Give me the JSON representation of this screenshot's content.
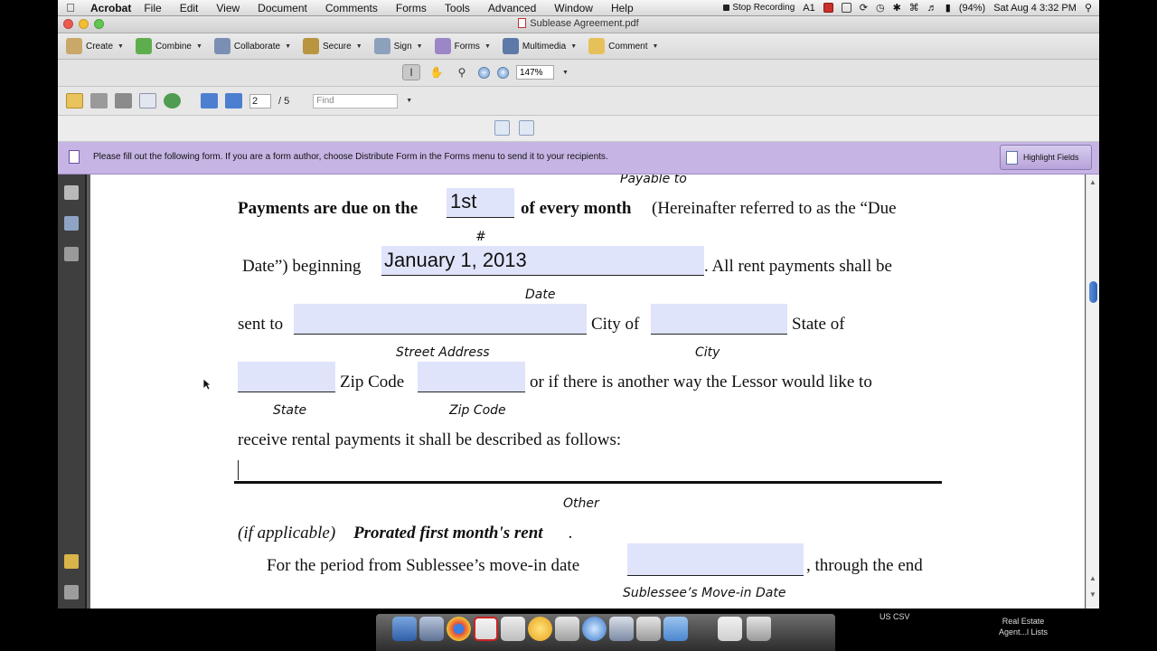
{
  "menubar": {
    "app_name": "Acrobat",
    "items": [
      "File",
      "Edit",
      "View",
      "Document",
      "Comments",
      "Forms",
      "Tools",
      "Advanced",
      "Window",
      "Help"
    ],
    "stop_recording": "Stop Recording",
    "badge_count": "1",
    "battery": "(94%)",
    "datetime": "Sat Aug 4  3:32 PM"
  },
  "window": {
    "title": "Sublease Agreement.pdf"
  },
  "toolbar1": [
    "Create",
    "Combine",
    "Collaborate",
    "Secure",
    "Sign",
    "Forms",
    "Multimedia",
    "Comment"
  ],
  "toolbar2": {
    "zoom": "147%"
  },
  "toolbar3": {
    "page_current": "2",
    "page_total": "/  5",
    "find_placeholder": "Find"
  },
  "form_bar": {
    "message": "Please fill out the following form. If you are a form author, choose Distribute Form in the Forms menu to send it to your recipients.",
    "highlight_button": "Highlight Fields"
  },
  "document": {
    "label_payable_to": "Payable to",
    "line1_bold_a": "Payments are due on the",
    "field_day_value": "1st",
    "line1_bold_b": "of every month",
    "line1_normal": "(Hereinafter referred to as the “Due",
    "label_hash": "#",
    "line2_a": "Date”) beginning",
    "field_date_value": "January 1, 2013",
    "line2_b": ". All rent payments shall be",
    "label_date": "Date",
    "line3_a": "sent to",
    "line3_b": "City of",
    "line3_c": "State of",
    "label_street": "Street Address",
    "label_city": "City",
    "line4_a": "Zip Code",
    "line4_b": "or if there is another way the Lessor would like to",
    "label_state": "State",
    "label_zip": "Zip Code",
    "line5": "receive rental payments it shall be described as follows:",
    "label_other": "Other",
    "line6_ital": "(if applicable)",
    "line6_bold": "Prorated first month's rent",
    "line6_end": ".",
    "line7_a": "For the period from Sublessee’s move-in date",
    "line7_b": ", through the end",
    "label_movein": "Sublessee’s Move-in Date"
  },
  "dock": {
    "label_us_csv": "US CSV",
    "label_stack_line1": "Real Estate",
    "label_stack_line2": "Agent...l Lists"
  }
}
